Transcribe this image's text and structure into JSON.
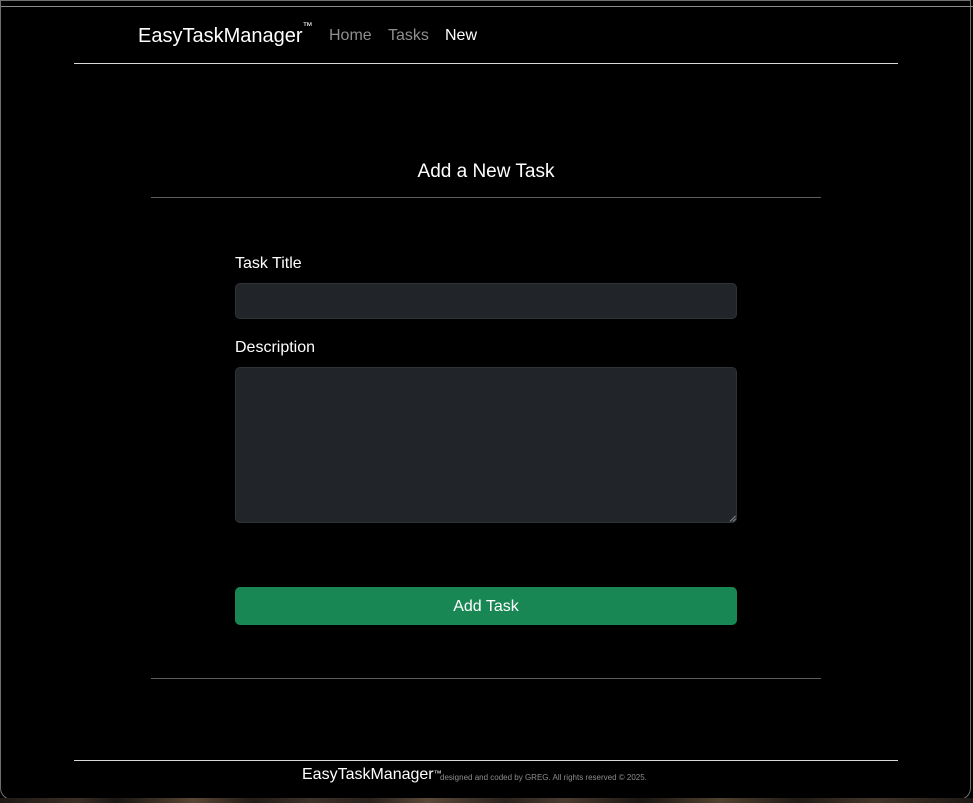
{
  "navbar": {
    "brand": "EasyTaskManager",
    "brand_mark": "™",
    "links": [
      {
        "label": "Home"
      },
      {
        "label": "Tasks"
      },
      {
        "label": "New"
      }
    ]
  },
  "form": {
    "title": "Add a New Task",
    "task_title_label": "Task Title",
    "task_title_value": "",
    "description_label": "Description",
    "description_value": "",
    "submit_label": "Add Task"
  },
  "footer": {
    "brand": "EasyTaskManager",
    "brand_mark": "™",
    "credit": "designed and coded by GREG. All rights reserved © 2025."
  },
  "colors": {
    "background": "#000000",
    "input_background": "#212529",
    "button_green": "#198754",
    "inactive_link": "#8f8f8f",
    "divider": "#5e5e5e"
  }
}
